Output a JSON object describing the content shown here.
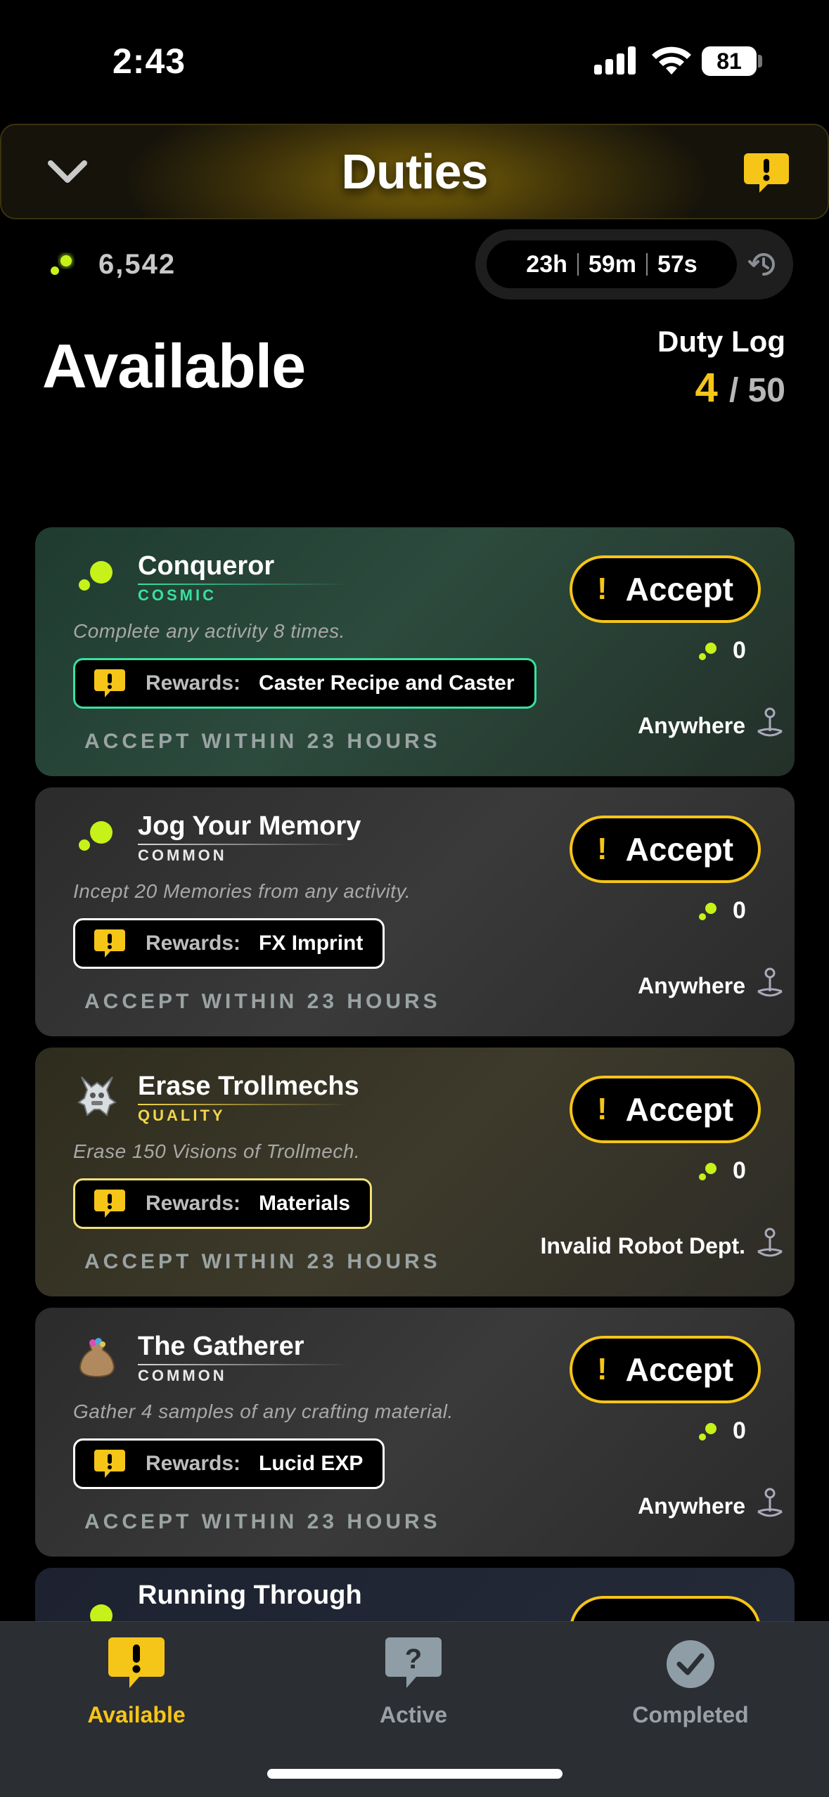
{
  "status_bar": {
    "time": "2:43",
    "battery": "81"
  },
  "header": {
    "title": "Duties"
  },
  "currency": {
    "value": "6,542"
  },
  "timer": {
    "hours": "23h",
    "minutes": "59m",
    "seconds": "57s"
  },
  "section": {
    "title": "Available"
  },
  "duty_log": {
    "label": "Duty Log",
    "current": "4",
    "total": "/ 50"
  },
  "colors": {
    "accent_yellow": "#f5c518",
    "lime": "#c6f21a",
    "cosmic_green": "#39e0a0",
    "quality_yellow": "#f1d64a"
  },
  "cards": [
    {
      "title": "Conqueror",
      "rarity": "COSMIC",
      "description": "Complete any activity 8 times.",
      "rewards_label": "Rewards:",
      "rewards_value": "Caster Recipe and Caster",
      "accept_within": "ACCEPT WITHIN 23 HOURS",
      "accept_label": "Accept",
      "progress": "0",
      "location": "Anywhere"
    },
    {
      "title": "Jog Your Memory",
      "rarity": "COMMON",
      "description": "Incept 20 Memories from any activity.",
      "rewards_label": "Rewards:",
      "rewards_value": "FX Imprint",
      "accept_within": "ACCEPT WITHIN 23 HOURS",
      "accept_label": "Accept",
      "progress": "0",
      "location": "Anywhere"
    },
    {
      "title": "Erase Trollmechs",
      "rarity": "QUALITY",
      "description": "Erase 150 Visions of Trollmech.",
      "rewards_label": "Rewards:",
      "rewards_value": "Materials",
      "accept_within": "ACCEPT WITHIN 23 HOURS",
      "accept_label": "Accept",
      "progress": "0",
      "location": "Invalid Robot Dept."
    },
    {
      "title": "The Gatherer",
      "rarity": "COMMON",
      "description": "Gather 4 samples of any crafting material.",
      "rewards_label": "Rewards:",
      "rewards_value": "Lucid EXP",
      "accept_within": "ACCEPT WITHIN 23 HOURS",
      "accept_label": "Accept",
      "progress": "0",
      "location": "Anywhere"
    },
    {
      "title": "Running Through"
    }
  ],
  "tabs": [
    {
      "label": "Available",
      "icon": "exclamation-bubble-icon"
    },
    {
      "label": "Active",
      "icon": "question-bubble-icon"
    },
    {
      "label": "Completed",
      "icon": "checkmark-circle-icon"
    }
  ]
}
